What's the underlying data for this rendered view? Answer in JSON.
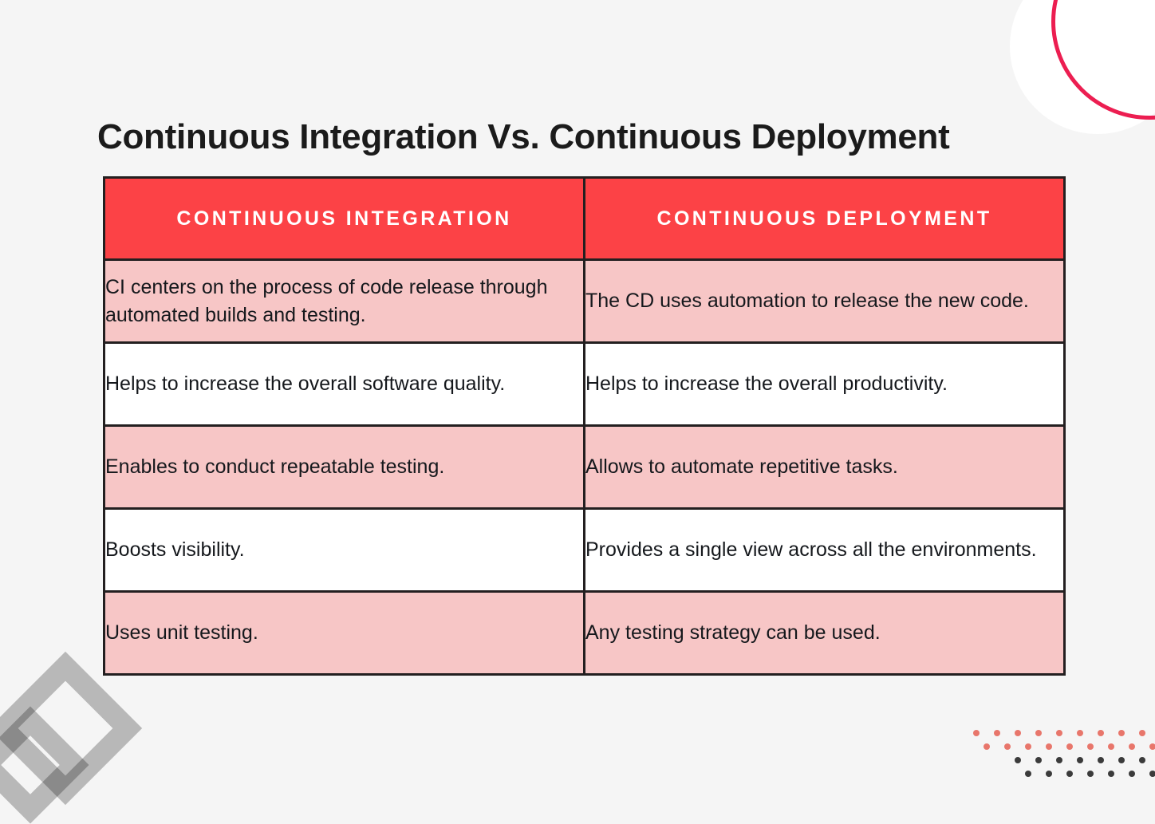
{
  "page": {
    "title": "Continuous Integration Vs. Continuous Deployment",
    "background_color": "#f5f5f5"
  },
  "theme": {
    "header_red": "#fc4246",
    "row_pink": "#f7c6c6",
    "row_white": "#ffffff",
    "border_dark": "#231f20",
    "text_dark": "#15181c",
    "accent_crimson": "#ec1e51",
    "dot_salmon": "#e8766b",
    "dot_dark": "#3b3b3b",
    "diamond_gray": "#a8a8a8"
  },
  "table": {
    "columns": [
      {
        "key": "ci",
        "header": "CONTINUOUS INTEGRATION"
      },
      {
        "key": "cd",
        "header": "CONTINUOUS DEPLOYMENT"
      }
    ],
    "rows": [
      {
        "shade": "pink",
        "ci": "CI centers on the process of code release through automated builds and testing.",
        "cd": "The CD uses automation to release the new code."
      },
      {
        "shade": "white",
        "ci": "Helps to increase the overall software quality.",
        "cd": "Helps to increase the overall productivity."
      },
      {
        "shade": "pink",
        "ci": "Enables to conduct repeatable testing.",
        "cd": "Allows to automate repetitive tasks."
      },
      {
        "shade": "white",
        "ci": "Boosts visibility.",
        "cd": "Provides a single view across all the environments."
      },
      {
        "shade": "pink",
        "ci": "Uses unit testing.",
        "cd": "Any testing strategy can be used."
      }
    ]
  },
  "decorations": {
    "top_right_circle": "white-circle-shape",
    "top_right_arc": "crimson-arc-shape",
    "bottom_left_diamonds": "gray-diamond-outline-shape",
    "bottom_right_dots": {
      "name": "dot-grid-shape",
      "rows": [
        {
          "color": "#e8766b",
          "count": 9,
          "offset": 0
        },
        {
          "color": "#e8766b",
          "count": 9,
          "offset": 13
        },
        {
          "color": "#3b3b3b",
          "count": 9,
          "offset": 52
        },
        {
          "color": "#3b3b3b",
          "count": 9,
          "offset": 65
        }
      ]
    }
  }
}
